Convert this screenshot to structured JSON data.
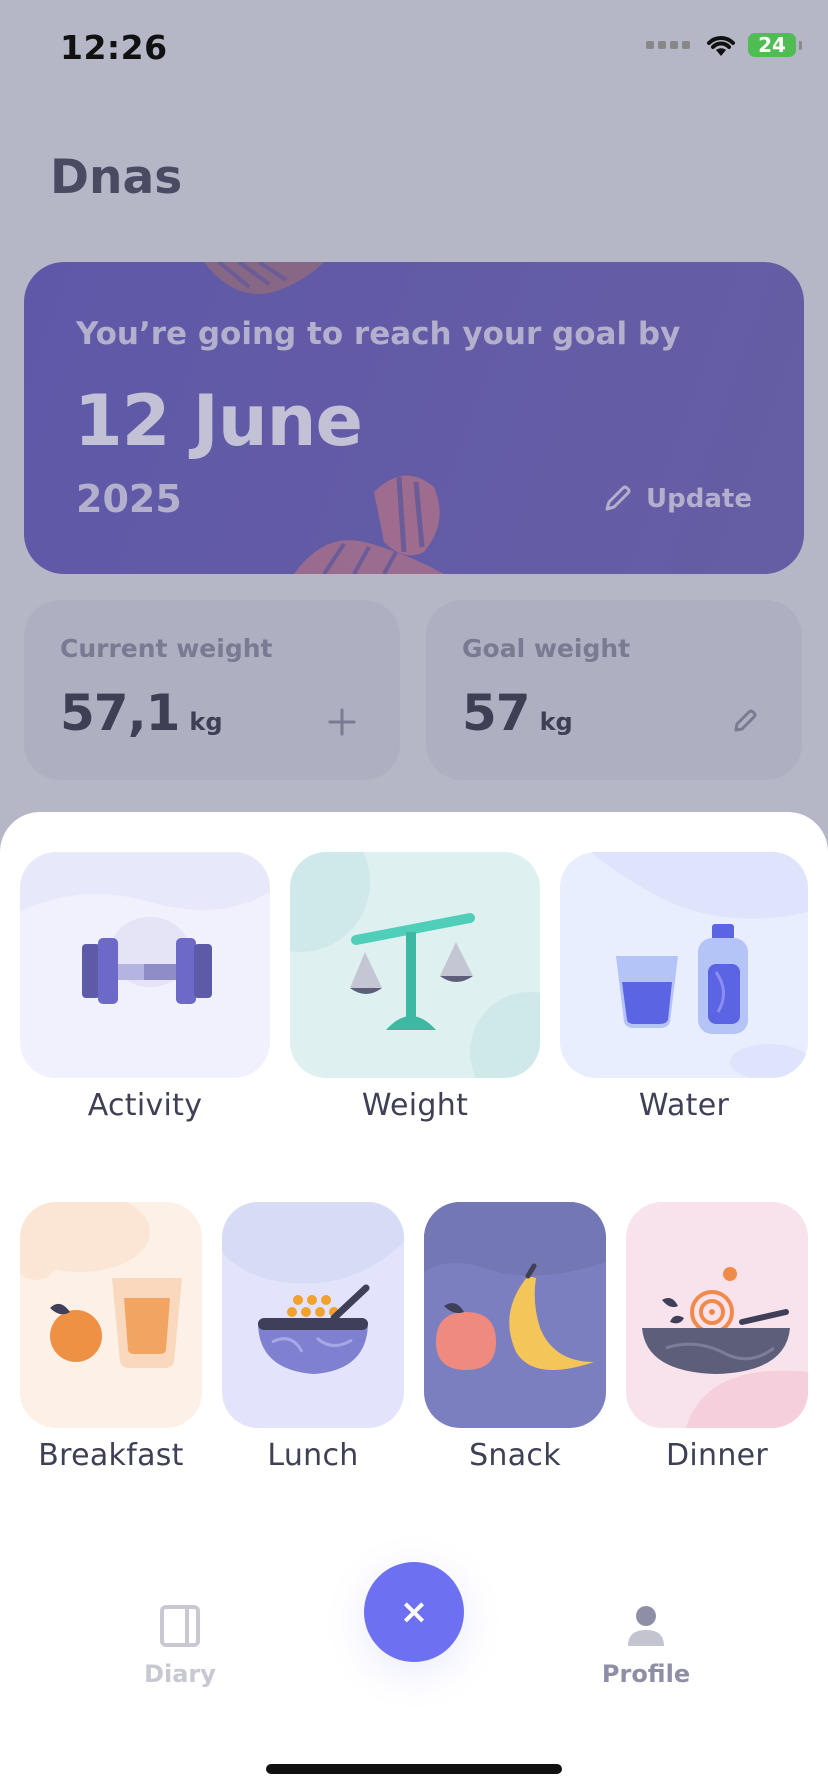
{
  "status_bar": {
    "time": "12:26",
    "battery": "24"
  },
  "header": {
    "title": "Dnas"
  },
  "goal_card": {
    "line": "You’re going to reach your goal by",
    "date": "12 June",
    "year": "2025",
    "update_label": "Update"
  },
  "current_weight": {
    "label": "Current weight",
    "value": "57,1",
    "unit": "kg"
  },
  "goal_weight": {
    "label": "Goal weight",
    "value": "57",
    "unit": "kg"
  },
  "sheet": {
    "row1": [
      {
        "label": "Activity",
        "icon": "dumbbell-icon"
      },
      {
        "label": "Weight",
        "icon": "scale-icon"
      },
      {
        "label": "Water",
        "icon": "water-icon"
      }
    ],
    "row2": [
      {
        "label": "Breakfast",
        "icon": "breakfast-icon"
      },
      {
        "label": "Lunch",
        "icon": "lunch-icon"
      },
      {
        "label": "Snack",
        "icon": "snack-icon"
      },
      {
        "label": "Dinner",
        "icon": "dinner-icon"
      }
    ]
  },
  "nav": {
    "diary": "Diary",
    "profile": "Profile",
    "close": "×"
  },
  "colors": {
    "accent": "#6d70f0",
    "goal_card": "#5f58a8"
  }
}
